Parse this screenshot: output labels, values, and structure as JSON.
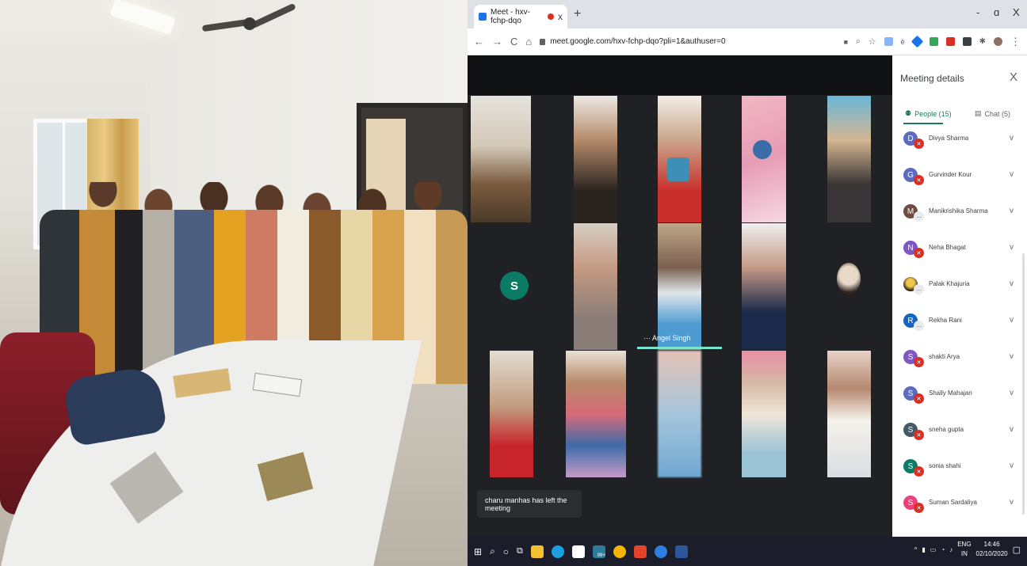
{
  "browser": {
    "tab_title": "Meet - hxv-fchp-dqo",
    "tab_close": "x",
    "new_tab": "+",
    "minimize": "-",
    "maximize": "ɑ",
    "close": "X",
    "url": "meet.google.com/hxv-fchp-dqo?pli=1&authuser=0"
  },
  "meet": {
    "avatar_letter": "S",
    "speaker_name": "Angel Singh",
    "toast": "charu manhas has left the meeting"
  },
  "sidebar": {
    "title": "Meeting details",
    "close": "X",
    "people_tab": "People (15)",
    "chat_tab": "Chat (5)",
    "people": [
      {
        "initial": "D",
        "name": "Divya Sharma",
        "color": "#5c6bc0",
        "badge": "mic-off"
      },
      {
        "initial": "G",
        "name": "Gurvinder Kour",
        "color": "#5c6bc0",
        "badge": "mic-off"
      },
      {
        "initial": "M",
        "name": "Manikrishika Sharma",
        "color": "#6d4c41",
        "badge": "more"
      },
      {
        "initial": "N",
        "name": "Neha Bhagat",
        "color": "#7e57c2",
        "badge": "mic-off"
      },
      {
        "initial": "",
        "name": "Palak Khajuria",
        "color": "#3b2a1e",
        "badge": "more"
      },
      {
        "initial": "R",
        "name": "Rekha Rani",
        "color": "#1565c0",
        "badge": "more"
      },
      {
        "initial": "S",
        "name": "shakti Arya",
        "color": "#7e57c2",
        "badge": "mic-off"
      },
      {
        "initial": "S",
        "name": "Shally Mahajan",
        "color": "#5c6bc0",
        "badge": "mic-off"
      },
      {
        "initial": "S",
        "name": "sneha gupta",
        "color": "#455a64",
        "badge": "mic-off"
      },
      {
        "initial": "S",
        "name": "sonia shahi",
        "color": "#0a7b64",
        "badge": "mic-off"
      },
      {
        "initial": "S",
        "name": "Suman Sardaliya",
        "color": "#ec407a",
        "badge": "mic-off"
      }
    ]
  },
  "taskbar": {
    "lang": "ENG",
    "region": "IN",
    "time": "14:46",
    "date": "02/10/2020",
    "badge": "99+"
  }
}
